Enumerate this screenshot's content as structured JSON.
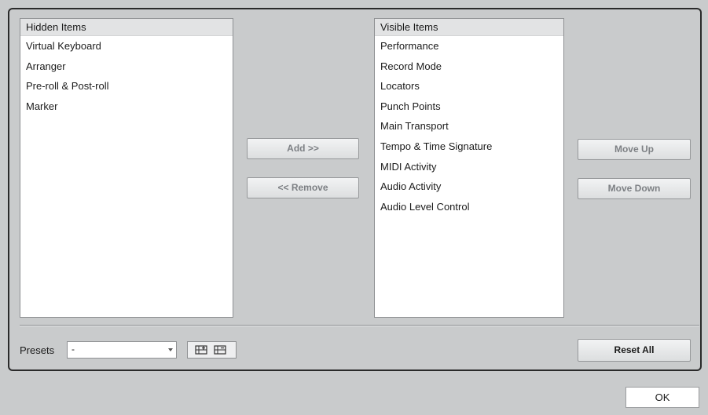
{
  "hidden_list": {
    "header": "Hidden Items",
    "items": [
      "Virtual Keyboard",
      "Arranger",
      "Pre-roll & Post-roll",
      "Marker"
    ]
  },
  "visible_list": {
    "header": "Visible Items",
    "items": [
      "Performance",
      "Record Mode",
      "Locators",
      "Punch Points",
      "Main Transport",
      "Tempo & Time Signature",
      "MIDI Activity",
      "Audio Activity",
      "Audio Level Control"
    ]
  },
  "buttons": {
    "add": "Add >>",
    "remove": "<< Remove",
    "move_up": "Move Up",
    "move_down": "Move Down",
    "reset_all": "Reset All",
    "ok": "OK"
  },
  "presets": {
    "label": "Presets",
    "selected": "-"
  },
  "icons": {
    "save_preset": "save-preset-icon",
    "remove_preset": "remove-preset-icon"
  }
}
